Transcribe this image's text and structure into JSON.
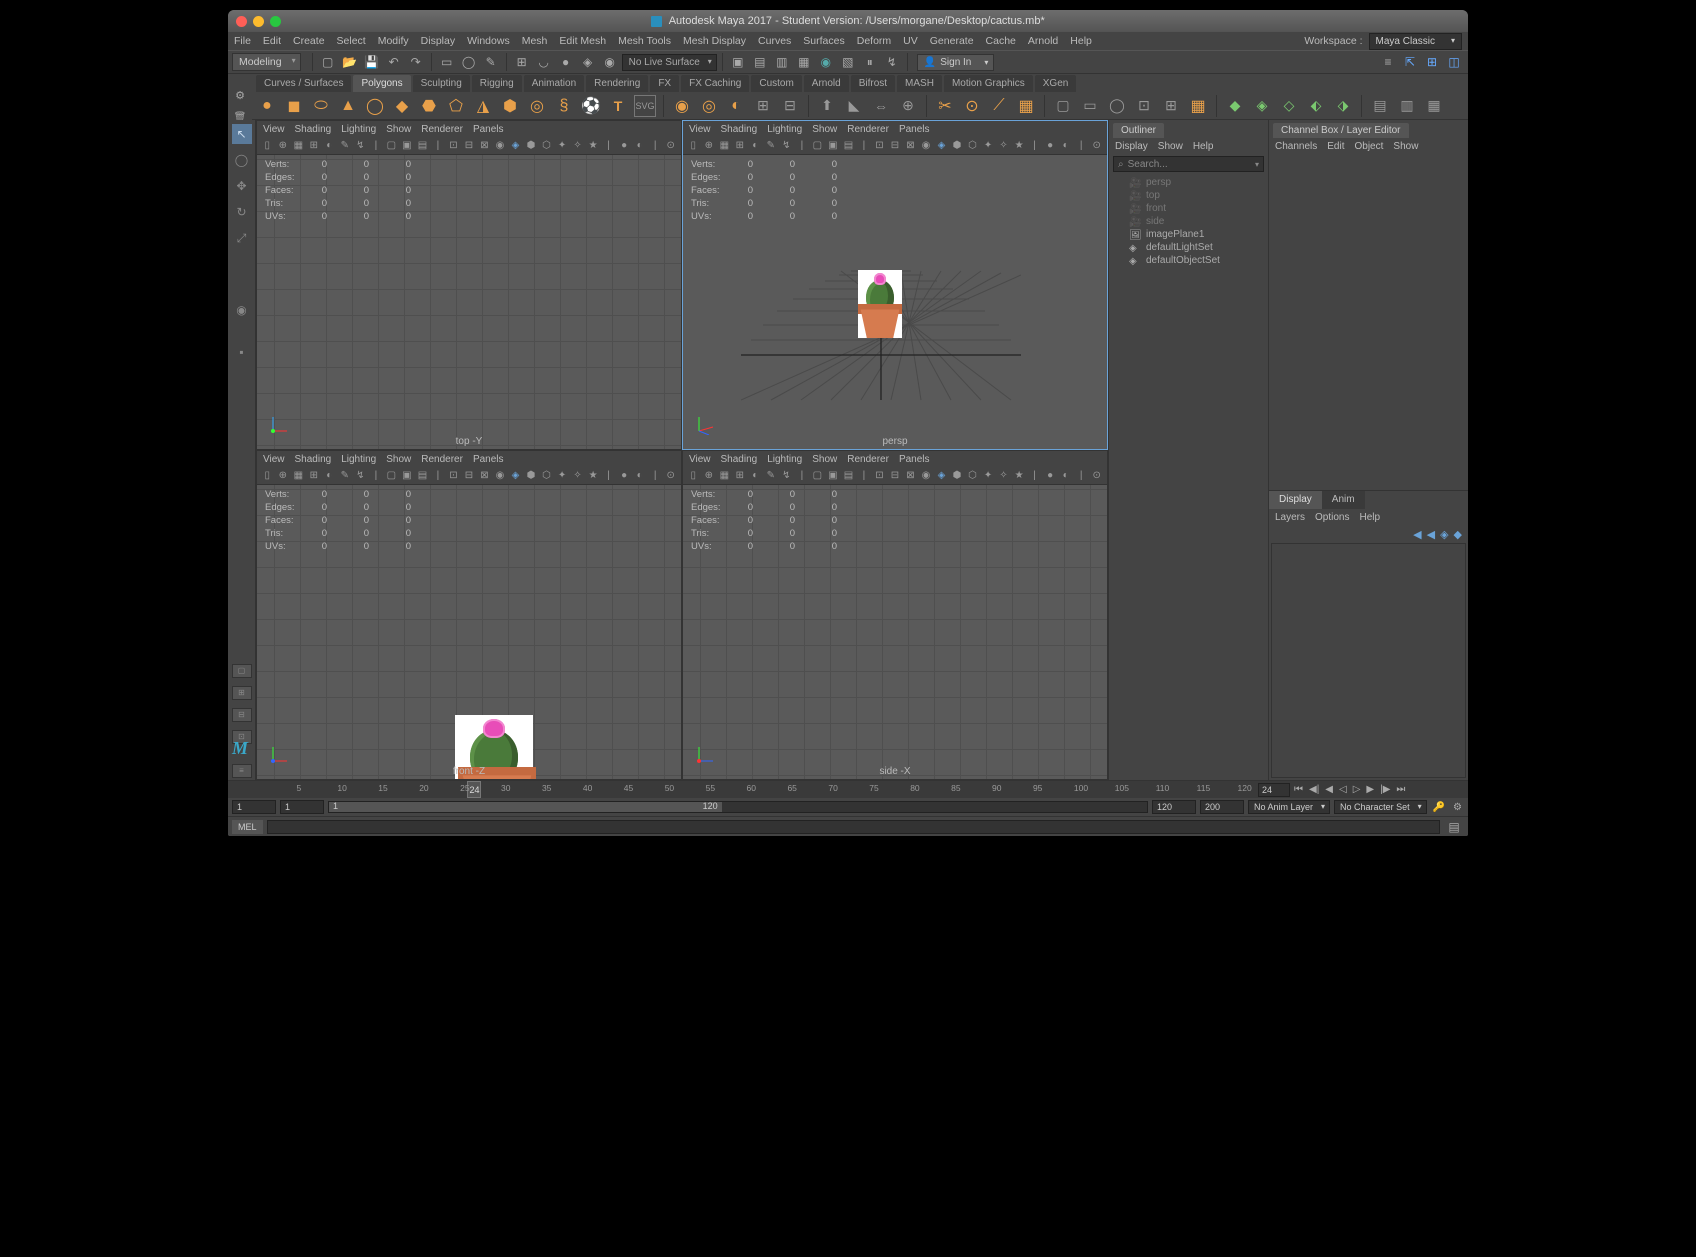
{
  "titlebar": {
    "title": "Autodesk Maya 2017 - Student Version: /Users/morgane/Desktop/cactus.mb*"
  },
  "mainmenu": [
    "File",
    "Edit",
    "Create",
    "Select",
    "Modify",
    "Display",
    "Windows",
    "Mesh",
    "Edit Mesh",
    "Mesh Tools",
    "Mesh Display",
    "Curves",
    "Surfaces",
    "Deform",
    "UV",
    "Generate",
    "Cache",
    "Arnold",
    "Help"
  ],
  "workspace": {
    "label": "Workspace :",
    "value": "Maya Classic"
  },
  "menuset": "Modeling",
  "livesurface": "No Live Surface",
  "signin": "Sign In",
  "shelftabs": [
    "Curves / Surfaces",
    "Polygons",
    "Sculpting",
    "Rigging",
    "Animation",
    "Rendering",
    "FX",
    "FX Caching",
    "Custom",
    "Arnold",
    "Bifrost",
    "MASH",
    "Motion Graphics",
    "XGen"
  ],
  "viewport_menu": [
    "View",
    "Shading",
    "Lighting",
    "Show",
    "Renderer",
    "Panels"
  ],
  "hud_rows": [
    "Verts:",
    "Edges:",
    "Faces:",
    "Tris:",
    "UVs:"
  ],
  "viewports": {
    "top": "top -Y",
    "persp": "persp",
    "front": "front -Z",
    "side": "side -X"
  },
  "outliner": {
    "title": "Outliner",
    "menu": [
      "Display",
      "Show",
      "Help"
    ],
    "search": "Search...",
    "items": [
      {
        "label": "persp",
        "dim": true,
        "ico": "cam"
      },
      {
        "label": "top",
        "dim": true,
        "ico": "cam"
      },
      {
        "label": "front",
        "dim": true,
        "ico": "cam"
      },
      {
        "label": "side",
        "dim": true,
        "ico": "cam"
      },
      {
        "label": "imagePlane1",
        "dim": false,
        "ico": "img"
      },
      {
        "label": "defaultLightSet",
        "dim": false,
        "ico": "set"
      },
      {
        "label": "defaultObjectSet",
        "dim": false,
        "ico": "set"
      }
    ]
  },
  "channelbox": {
    "title": "Channel Box / Layer Editor",
    "menu": [
      "Channels",
      "Edit",
      "Object",
      "Show"
    ]
  },
  "layers": {
    "tabs": [
      "Display",
      "Anim"
    ],
    "menu": [
      "Layers",
      "Options",
      "Help"
    ]
  },
  "timeslider": {
    "ticks": [
      "5",
      "10",
      "15",
      "20",
      "25",
      "30",
      "35",
      "40",
      "45",
      "50",
      "55",
      "60",
      "65",
      "70",
      "75",
      "80",
      "85",
      "90",
      "95",
      "100",
      "105",
      "110",
      "115",
      "120"
    ],
    "current": "24",
    "field": "24"
  },
  "range": {
    "start": "1",
    "in": "1",
    "track_in": "1",
    "track_out": "120",
    "out": "120",
    "end": "200",
    "animlayer": "No Anim Layer",
    "charset": "No Character Set"
  },
  "cmd": {
    "label": "MEL"
  },
  "zero": "0"
}
